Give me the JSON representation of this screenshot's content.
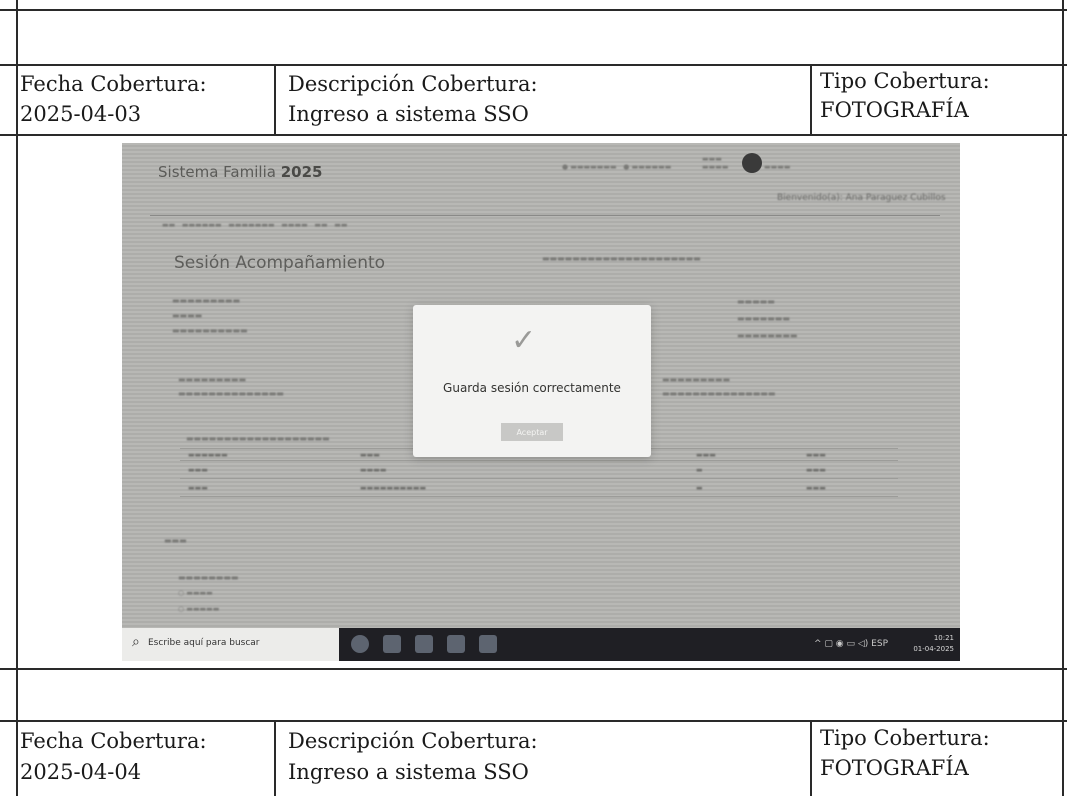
{
  "entries": [
    {
      "fecha_label": "Fecha Cobertura:",
      "fecha_value": "2025-04-03",
      "desc_label": "Descripción Cobertura:",
      "desc_value": "Ingreso a sistema SSO",
      "tipo_label": "Tipo Cobertura:",
      "tipo_value": "FOTOGRAFÍA"
    },
    {
      "fecha_label": "Fecha Cobertura:",
      "fecha_value": "2025-04-04",
      "desc_label": "Descripción Cobertura:",
      "desc_value": "Ingreso a sistema SSO",
      "tipo_label": "Tipo Cobertura:",
      "tipo_value": "FOTOGRAFÍA"
    }
  ],
  "photo": {
    "app_title_prefix": "Sistema Familia",
    "app_title_year": "2025",
    "welcome": "Bienvenido(a): Ana Paraguez Cubillos",
    "page_title": "Sesión Acompañamiento",
    "modal": {
      "check_glyph": "✓",
      "message": "Guarda sesión correctamente",
      "button": "Aceptar"
    },
    "taskbar": {
      "search_placeholder": "Escribe aquí para buscar",
      "clock_time": "10:21",
      "clock_date": "01-04-2025",
      "language": "ESP"
    }
  }
}
